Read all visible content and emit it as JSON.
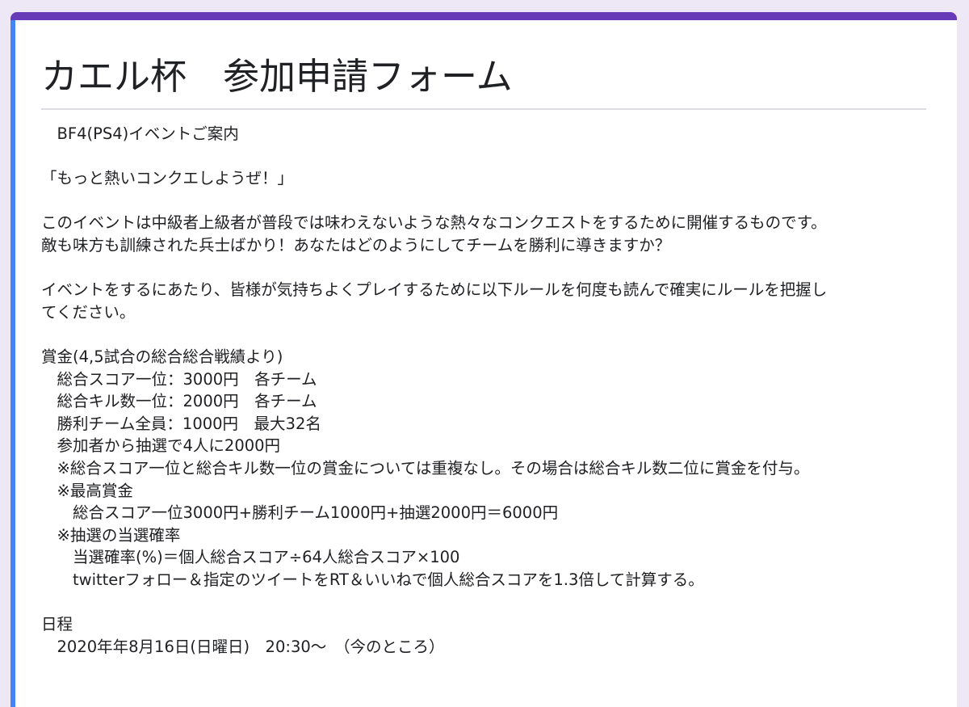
{
  "form": {
    "title": "カエル杯　参加申請フォーム",
    "description_lines": [
      "　BF4(PS4)イベントご案内",
      "",
      "「もっと熱いコンクエしようぜ！」",
      "",
      "このイベントは中級者上級者が普段では味わえないような熱々なコンクエストをするために開催するものです。",
      "敵も味方も訓練された兵士ばかり！あなたはどのようにしてチームを勝利に導きますか？",
      "",
      "イベントをするにあたり、皆様が気持ちよくプレイするために以下ルールを何度も読んで確実にルールを把握し",
      "てください。",
      "",
      "賞金(4,5試合の総合総合戦績より)",
      "　総合スコア一位：3000円　各チーム",
      "　総合キル数一位：2000円　各チーム",
      "　勝利チーム全員：1000円　最大32名",
      "　参加者から抽選で4人に2000円",
      "　※総合スコア一位と総合キル数一位の賞金については重複なし。その場合は総合キル数二位に賞金を付与。",
      "　※最高賞金",
      "　　総合スコア一位3000円+勝利チーム1000円+抽選2000円＝6000円",
      "　※抽選の当選確率",
      "　　当選確率(%)＝個人総合スコア÷64人総合スコア×100",
      "　　twitterフォロー＆指定のツイートをRT＆いいねで個人総合スコアを1.3倍して計算する。",
      "",
      "日程",
      "　2020年年8月16日(日曜日)　20:30～　（今のところ）"
    ]
  },
  "colors": {
    "accent_top": "#673ab7",
    "accent_left": "#4285f4",
    "background": "#ede7f6"
  }
}
